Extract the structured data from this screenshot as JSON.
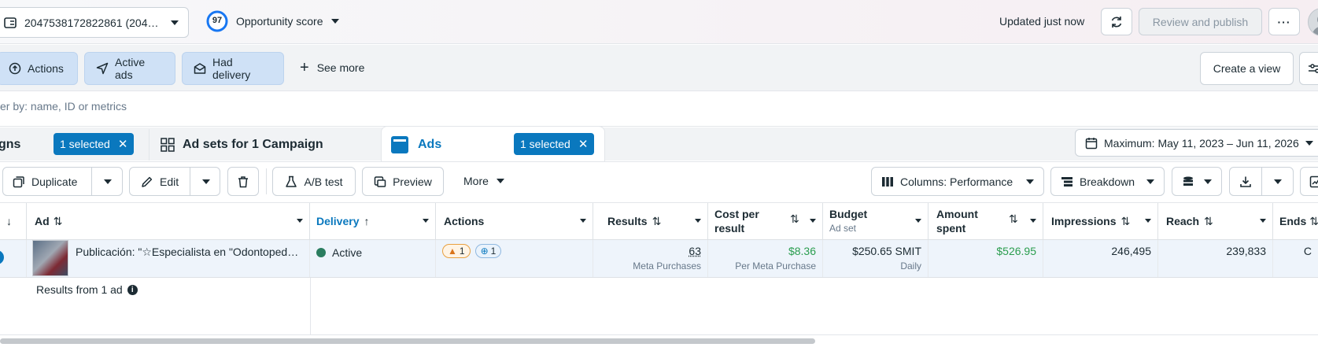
{
  "topbar": {
    "account_id": "2047538172822861 (204…",
    "score_value": "97",
    "score_label": "Opportunity score",
    "updated": "Updated just now",
    "review_publish": "Review and publish"
  },
  "filters": {
    "chips": [
      "Actions",
      "Active ads",
      "Had delivery"
    ],
    "see_more": "See more",
    "create_view": "Create a view",
    "search_placeholder": "er by: name, ID or metrics"
  },
  "tabs": {
    "campaigns_label": "gns",
    "campaigns_selected": "1 selected",
    "adsets_label": "Ad sets for 1 Campaign",
    "ads_label": "Ads",
    "ads_selected": "1 selected",
    "date_range": "Maximum: May 11, 2023 – Jun 11, 2026"
  },
  "toolbar": {
    "duplicate": "Duplicate",
    "edit": "Edit",
    "ab_test": "A/B test",
    "preview": "Preview",
    "more": "More",
    "columns": "Columns: Performance",
    "breakdown": "Breakdown"
  },
  "table": {
    "headers": {
      "ad": "Ad",
      "delivery": "Delivery",
      "actions": "Actions",
      "results": "Results",
      "cost_line1": "Cost per",
      "cost_line2": "result",
      "budget": "Budget",
      "budget_sub": "Ad set",
      "amount_line1": "Amount",
      "amount_line2": "spent",
      "impressions": "Impressions",
      "reach": "Reach",
      "ends": "Ends"
    },
    "row": {
      "ad_name": "Publicación: \"☆Especialista en \"Odontoped…",
      "delivery": "Active",
      "warning_count": "1",
      "action_count": "1",
      "results": "63",
      "results_sub": "Meta Purchases",
      "cost": "$8.36",
      "cost_sub": "Per Meta Purchase",
      "budget": "$250.65 SMIT",
      "budget_sub": "Daily",
      "amount": "$526.95",
      "impressions": "246,495",
      "reach": "239,833",
      "ends": "C"
    },
    "footer": "Results from 1 ad"
  },
  "colors": {
    "accent": "#0a78be",
    "green": "#2a9d4e",
    "chip_bg": "#cfe1f6"
  }
}
